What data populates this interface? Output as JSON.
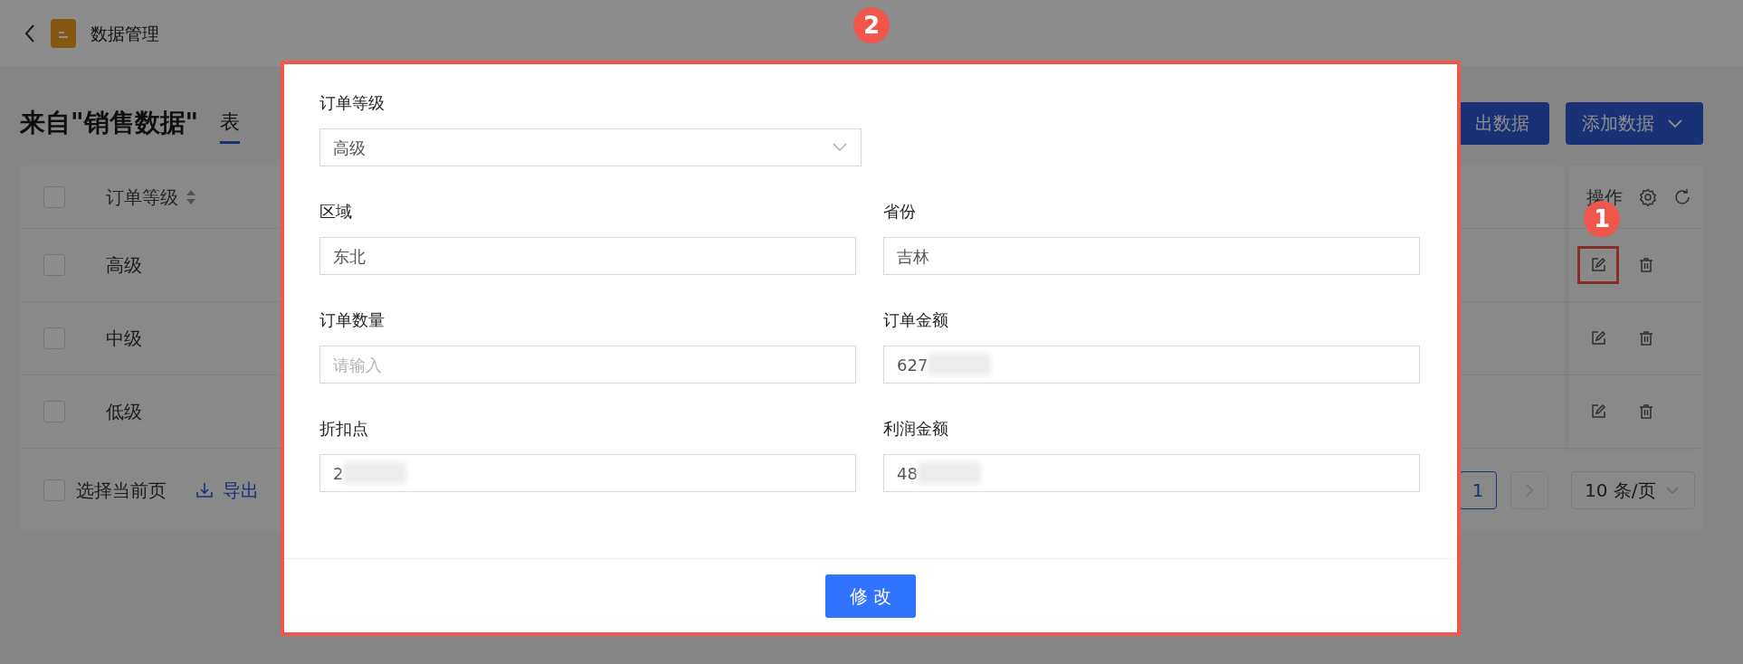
{
  "header": {
    "title": "数据管理"
  },
  "page": {
    "title": "来自\"销售数据\"",
    "tab": {
      "label": "表",
      "selected": true
    }
  },
  "toolbar_buttons": [
    {
      "label": "出数据",
      "dropdown": false
    },
    {
      "label": "添加数据",
      "dropdown": true
    }
  ],
  "table": {
    "select_all": {
      "checked": false
    },
    "columns": [
      {
        "label": "订单等级",
        "sortable": true
      }
    ],
    "action_column": {
      "label": "操作"
    },
    "rows": [
      {
        "checked": false,
        "cells": [
          "高级"
        ],
        "highlighted": true
      },
      {
        "checked": false,
        "cells": [
          "中级"
        ],
        "highlighted": false
      },
      {
        "checked": false,
        "cells": [
          "低级"
        ],
        "highlighted": false
      }
    ],
    "footer": {
      "select_page": {
        "label": "选择当前页",
        "checked": false
      },
      "export": "导出",
      "pages": [
        {
          "label": "1",
          "selected": true
        }
      ],
      "page_size": "10 条/页"
    }
  },
  "modal": {
    "fields": [
      {
        "label": "订单等级",
        "kind": "select",
        "value": "高级"
      },
      {
        "label": "区域",
        "kind": "input",
        "value": "东北"
      },
      {
        "label": "省份",
        "kind": "input",
        "value": "吉林"
      },
      {
        "label": "订单数量",
        "kind": "input",
        "placeholder": "请输入"
      },
      {
        "label": "订单金额",
        "kind": "input",
        "value": "627",
        "redacted": true
      },
      {
        "label": "折扣点",
        "kind": "input",
        "value": "2",
        "redacted": true
      },
      {
        "label": "利润金额",
        "kind": "input",
        "value": "48",
        "redacted": true
      }
    ],
    "submit": "修 改"
  },
  "callouts": [
    {
      "number": "1"
    },
    {
      "number": "2"
    }
  ]
}
